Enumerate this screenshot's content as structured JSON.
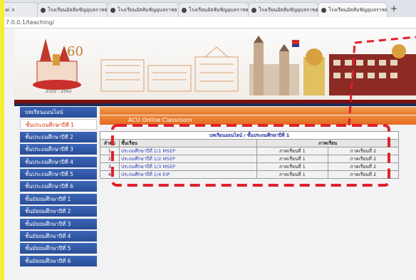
{
  "browser": {
    "tabs": [
      {
        "title": "ai ×"
      },
      {
        "title": "โรงเรียนอัสสัมชัญอุบลราชธานี"
      },
      {
        "title": "โรงเรียนอัสสัมชัญอุบลราชธานี"
      },
      {
        "title": "โรงเรียนอัสสัมชัญอุบลราชธานี"
      },
      {
        "title": "โรงเรียนอัสสัมชัญอุบลราชธานี"
      },
      {
        "title": "โรงเรียนอัสสัมชัญอุบลราชธานี"
      }
    ],
    "new_tab": "+",
    "url": "7.0.0.1/teaching/"
  },
  "banner": {
    "logo_text": "60",
    "logo_years": "2502 - 2562"
  },
  "sidebar": {
    "items": [
      {
        "label": "บทเรียนออนไลน์"
      },
      {
        "label": "ชั้นประถมศึกษาปีที่ 1"
      },
      {
        "label": "ชั้นประถมศึกษาปีที่ 2"
      },
      {
        "label": "ชั้นประถมศึกษาปีที่ 3"
      },
      {
        "label": "ชั้นประถมศึกษาปีที่ 4"
      },
      {
        "label": "ชั้นประถมศึกษาปีที่ 5"
      },
      {
        "label": "ชั้นประถมศึกษาปีที่ 6"
      },
      {
        "label": "ชั้นมัธยมศึกษาปีที่ 1"
      },
      {
        "label": "ชั้นมัธยมศึกษาปีที่ 2"
      },
      {
        "label": "ชั้นมัธยมศึกษาปีที่ 3"
      },
      {
        "label": "ชั้นมัธยมศึกษาปีที่ 4"
      },
      {
        "label": "ชั้นมัธยมศึกษาปีที่ 5"
      },
      {
        "label": "ชั้นมัธยมศึกษาปีที่ 6"
      }
    ]
  },
  "content": {
    "section_title": "ACU Online Classroom",
    "table_title": "บทเรียนออนไลน์ / ชั้นประถมศึกษาปีที่ 1",
    "col_order": "ลำดับ",
    "col_class": "ชั้นเรียน",
    "col_semester": "ภาคเรียน",
    "rows": [
      {
        "no": "1",
        "course": "ประถมศึกษาปีที่ 1/1 MSEP",
        "sem1": "ภาคเรียนที่ 1",
        "sem2": "ภาคเรียนที่ 2"
      },
      {
        "no": "2",
        "course": "ประถมศึกษาปีที่ 1/2 MSEP",
        "sem1": "ภาคเรียนที่ 1",
        "sem2": "ภาคเรียนที่ 2"
      },
      {
        "no": "3",
        "course": "ประถมศึกษาปีที่ 1/3 MSEP",
        "sem1": "ภาคเรียนที่ 1",
        "sem2": "ภาคเรียนที่ 2"
      },
      {
        "no": "4",
        "course": "ประถมศึกษาปีที่ 1/4 EIP",
        "sem1": "ภาคเรียนที่ 1",
        "sem2": "ภาคเรียนที่ 2"
      }
    ]
  },
  "colors": {
    "sidebar": "#2f56a6",
    "accent_orange": "#e5762a",
    "annotation_red": "#e0202a",
    "frame_yellow": "#f4ef34"
  }
}
